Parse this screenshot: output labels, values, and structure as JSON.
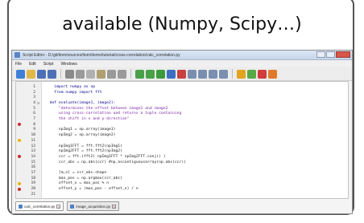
{
  "caption": {
    "text": "available (Numpy, Scipy…)"
  },
  "window": {
    "title": "Script Editor - D:/git/itom/sources/itom/demo/tutorial/cross-correlation/calc_correlation.py",
    "colors": {
      "titlebar": "#c6d6ea",
      "editor_bg": "#ffffff",
      "keyword": "#00008b",
      "docstring": "#7a1fa2",
      "comment": "#4caf50"
    }
  },
  "menubar": {
    "items": [
      "File",
      "Edit",
      "Script",
      "Windows"
    ]
  },
  "toolbar": {
    "buttons": [
      {
        "name": "new-script-icon",
        "color": "#3f7fd6"
      },
      {
        "name": "open-file-icon",
        "color": "#e0b84a"
      },
      {
        "name": "save-icon",
        "color": "#4d6fb5"
      },
      {
        "name": "save-as-icon",
        "color": "#4d6fb5"
      },
      {
        "name": "print-icon",
        "color": "#8a8a8a"
      },
      {
        "name": "cut-icon",
        "color": "#9a9a9a"
      },
      {
        "name": "copy-icon",
        "color": "#b0b0b0"
      },
      {
        "name": "paste-icon",
        "color": "#b0a070"
      },
      {
        "name": "undo-icon",
        "color": "#9a9a9a"
      },
      {
        "name": "redo-icon",
        "color": "#9a9a9a"
      },
      {
        "name": "comment-icon",
        "color": "#4aa048"
      },
      {
        "name": "uncomment-icon",
        "color": "#4aa048"
      },
      {
        "name": "run-icon",
        "color": "#3c9a3c"
      },
      {
        "name": "debug-icon",
        "color": "#3c6fc0"
      },
      {
        "name": "stop-icon",
        "color": "#c84040"
      },
      {
        "name": "step-over-icon",
        "color": "#7a8fb0"
      },
      {
        "name": "step-into-icon",
        "color": "#7a8fb0"
      },
      {
        "name": "step-out-icon",
        "color": "#7a8fb0"
      },
      {
        "name": "continue-icon",
        "color": "#7a8fb0"
      },
      {
        "name": "breakpoint-icon",
        "color": "#e2a31d"
      },
      {
        "name": "bookmark-icon",
        "color": "#58a845"
      },
      {
        "name": "toggle-breakpoint-icon",
        "color": "#d23c3c"
      },
      {
        "name": "clear-breakpoints-icon",
        "color": "#e07a2a"
      }
    ]
  },
  "editor": {
    "lines": [
      {
        "n": "1",
        "marker": "",
        "text": "    import numpy as np",
        "color": "#00008b"
      },
      {
        "n": "2",
        "marker": "",
        "text": "    from numpy import fft",
        "color": "#00008b"
      },
      {
        "n": "3",
        "marker": "",
        "text": "",
        "color": "#1a1a1a"
      },
      {
        "n": "4",
        "marker": "",
        "text": "  def evaluate(image1, image2):",
        "color": "#00008b"
      },
      {
        "n": "5",
        "marker": "",
        "text": "      \"determines the offset between image1 and image2",
        "color": "#7a1fa2"
      },
      {
        "n": "6",
        "marker": "",
        "text": "      using cross-correlation and returns a tuple containing",
        "color": "#7a1fa2"
      },
      {
        "n": "7",
        "marker": "",
        "text": "      the shift in x and y-direction\"",
        "color": "#7a1fa2"
      },
      {
        "n": "8",
        "marker": "bp",
        "text": "",
        "color": "#1a1a1a"
      },
      {
        "n": "9",
        "marker": "",
        "text": "      npImg1 = np.array(image1)",
        "color": "#1a1a1a"
      },
      {
        "n": "10",
        "marker": "",
        "text": "      npImg2 = np.array(image2)",
        "color": "#1a1a1a"
      },
      {
        "n": "11",
        "marker": "warn",
        "text": "",
        "color": "#1a1a1a"
      },
      {
        "n": "12",
        "marker": "",
        "text": "      npImg1FFT = fft.fft2(npImg1)",
        "color": "#1a1a1a"
      },
      {
        "n": "13",
        "marker": "",
        "text": "      npImg2FFT = fft.fft2(npImg2)",
        "color": "#1a1a1a"
      },
      {
        "n": "14",
        "marker": "bp",
        "text": "      ccr = fft.ifft2( npImg1FFT * npImg2FFT.conj() )",
        "color": "#1a1a1a"
      },
      {
        "n": "15",
        "marker": "",
        "text": "      ccr_abs = np.abs(ccr) #np.ascontiguousarray(np.abs(ccr))",
        "color": "#1a1a1a"
      },
      {
        "n": "16",
        "marker": "",
        "text": "",
        "color": "#1a1a1a"
      },
      {
        "n": "17",
        "marker": "",
        "text": "      [m,n] = ccr_abs.shape",
        "color": "#1a1a1a"
      },
      {
        "n": "18",
        "marker": "",
        "text": "      max_pos = np.argmax(ccr_abs)",
        "color": "#1a1a1a"
      },
      {
        "n": "19",
        "marker": "warn",
        "text": "      offset_x = max_pos % n",
        "color": "#1a1a1a"
      },
      {
        "n": "20",
        "marker": "bp",
        "text": "      offset_y = (max_pos - offset_x) / n",
        "color": "#1a1a1a"
      },
      {
        "n": "21",
        "marker": "",
        "text": "",
        "color": "#1a1a1a"
      }
    ]
  },
  "tabs": [
    {
      "label": "calc_correlation.py",
      "active": true
    },
    {
      "label": "image_acquisition.py",
      "active": false
    }
  ]
}
